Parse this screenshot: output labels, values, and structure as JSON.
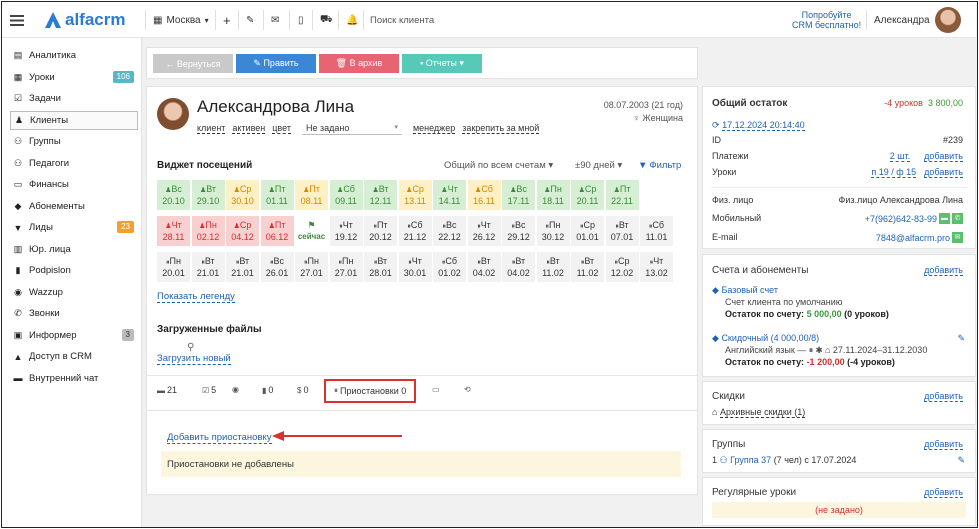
{
  "topbar": {
    "logo": "alfacrm",
    "city": "Москва",
    "search_placeholder": "Поиск клиента",
    "try_line1": "Попробуйте",
    "try_line2": "CRM бесплатно!",
    "user": "Александра"
  },
  "sidebar": [
    {
      "label": "Аналитика",
      "icon": "chart-icon"
    },
    {
      "label": "Уроки",
      "icon": "calendar-icon",
      "badge": "106",
      "badge_color": "#5bb5c8"
    },
    {
      "label": "Задачи",
      "icon": "tasks-icon"
    },
    {
      "label": "Клиенты",
      "icon": "user-icon",
      "active": true
    },
    {
      "label": "Группы",
      "icon": "group-icon"
    },
    {
      "label": "Педагоги",
      "icon": "teacher-icon"
    },
    {
      "label": "Финансы",
      "icon": "money-icon"
    },
    {
      "label": "Абонементы",
      "icon": "tag-icon"
    },
    {
      "label": "Лиды",
      "icon": "funnel-icon",
      "badge": "23",
      "badge_color": "#f0a030"
    },
    {
      "label": "Юр. лица",
      "icon": "building-icon"
    },
    {
      "label": "Podpislon",
      "icon": "doc-icon"
    },
    {
      "label": "Wazzup",
      "icon": "whatsapp-icon"
    },
    {
      "label": "Звонки",
      "icon": "phone-icon"
    },
    {
      "label": "Информер",
      "icon": "informer-icon",
      "badge": "3",
      "badge_color": "#bbb",
      "badge_text": "#333"
    },
    {
      "label": "Доступ в CRM",
      "icon": "lock-icon"
    },
    {
      "label": "Внутренний чат",
      "icon": "chat-icon"
    }
  ],
  "toolbar": {
    "back": "← Вернуться",
    "edit": "✎ Править",
    "archive": "🗑 В архив",
    "reports": "▪ Отчеты ▾"
  },
  "client": {
    "name": "Александрова Лина",
    "date": "08.07.2003 (21 год)",
    "gender": "♀ Женщина",
    "tags": [
      "клиент",
      "активен",
      "цвет"
    ],
    "select": "Не задано",
    "manager": "менеджер",
    "pin": "закрепить за мной"
  },
  "widget": {
    "title": "Виджет посещений",
    "filter1": "Общий по всем счетам ▾",
    "filter2": "±90 дней ▾",
    "filter_btn": "Фильтр",
    "legend_link": "Показать легенду"
  },
  "cells": [
    [
      "g",
      "Вс",
      "20.10"
    ],
    [
      "g",
      "Вт",
      "29.10"
    ],
    [
      "y",
      "Ср",
      "30.10"
    ],
    [
      "g",
      "Пт",
      "01.11"
    ],
    [
      "y",
      "Пт",
      "08.11"
    ],
    [
      "g",
      "Сб",
      "09.11"
    ],
    [
      "g",
      "Вт",
      "12.11"
    ],
    [
      "y",
      "Ср",
      "13.11"
    ],
    [
      "g",
      "Чт",
      "14.11"
    ],
    [
      "y",
      "Сб",
      "16.11"
    ],
    [
      "g",
      "Вс",
      "17.11"
    ],
    [
      "g",
      "Пн",
      "18.11"
    ],
    [
      "g",
      "Ср",
      "20.11"
    ],
    [
      "g",
      "Пт",
      "22.11"
    ],
    [
      "r",
      "Чт",
      "28.11"
    ],
    [
      "r",
      "Пн",
      "02.12"
    ],
    [
      "r",
      "Ср",
      "04.12"
    ],
    [
      "r",
      "Пт",
      "06.12"
    ],
    [
      "now",
      "",
      "сейчас"
    ],
    [
      "n",
      "Чт",
      "19.12"
    ],
    [
      "n",
      "Пт",
      "20.12"
    ],
    [
      "n",
      "Сб",
      "21.12"
    ],
    [
      "n",
      "Вс",
      "22.12"
    ],
    [
      "n",
      "Чт",
      "26.12"
    ],
    [
      "n",
      "Вс",
      "29.12"
    ],
    [
      "n",
      "Пн",
      "30.12"
    ],
    [
      "n",
      "Ср",
      "01.01"
    ],
    [
      "n",
      "Вт",
      "07.01"
    ],
    [
      "n",
      "Сб",
      "11.01"
    ],
    [
      "n",
      "Пн",
      "20.01"
    ],
    [
      "n",
      "Вт",
      "21.01"
    ],
    [
      "n",
      "Вт",
      "21.01"
    ],
    [
      "n",
      "Вс",
      "26.01"
    ],
    [
      "n",
      "Пн",
      "27.01"
    ],
    [
      "n",
      "Пн",
      "27.01"
    ],
    [
      "n",
      "Вт",
      "28.01"
    ],
    [
      "n",
      "Чт",
      "30.01"
    ],
    [
      "n",
      "Сб",
      "01.02"
    ],
    [
      "n",
      "Вт",
      "04.02"
    ],
    [
      "n",
      "Вт",
      "04.02"
    ],
    [
      "n",
      "Вт",
      "11.02"
    ],
    [
      "n",
      "Вт",
      "11.02"
    ],
    [
      "n",
      "Ср",
      "12.02"
    ],
    [
      "n",
      "Чт",
      "13.02"
    ]
  ],
  "files": {
    "title": "Загруженные файлы",
    "upload": "Загрузить новый"
  },
  "tabs": [
    {
      "label": "21",
      "icon": "comment-icon"
    },
    {
      "label": "5",
      "icon": "tasks-icon"
    },
    {
      "label": "",
      "icon": "whatsapp-icon"
    },
    {
      "label": "0",
      "icon": "doc-icon"
    },
    {
      "label": "0",
      "icon": "dollar-icon"
    },
    {
      "label": "Приостановки 0",
      "icon": "pause-icon",
      "active": true
    },
    {
      "label": "",
      "icon": "ticket-icon"
    },
    {
      "label": "",
      "icon": "history-icon"
    }
  ],
  "pauses": {
    "add": "Добавить приостановку",
    "empty": "Приостановки не добавлены"
  },
  "balance": {
    "title": "Общий остаток",
    "lessons": "-4 уроков",
    "money": "3 800,00",
    "date": "17.12.2024 20:14:40",
    "id_label": "ID",
    "id": "#239",
    "pay_label": "Платежи",
    "pay_val": "2 шт.",
    "lessons_label": "Уроки",
    "lessons_val": "п 19 / ф 15",
    "add": "добавить"
  },
  "contacts": {
    "type_label": "Физ. лицо",
    "type_val": "Физ.лицо Александрова Лина",
    "mob_label": "Мобильный",
    "mob_val": "+7(962)642-83-99",
    "email_label": "E-mail",
    "email_val": "7848@alfacrm.pro"
  },
  "accounts": {
    "title": "Счета и абонементы",
    "add": "добавить",
    "base": "Базовый счет",
    "base_desc": "Счет клиента по умолчанию",
    "base_rest_label": "Остаток по счету:",
    "base_rest_money": "5 000,00",
    "base_rest_lessons": "(0 уроков)",
    "disc": "Скидочный (4 000,00/8)",
    "disc_desc": "Английский язык — ⏸ ✱ ⌂ 27.11.2024–31.12.2030",
    "disc_rest_label": "Остаток по счету:",
    "disc_rest_money": "-1 200,00",
    "disc_rest_lessons": "(-4 уроков)"
  },
  "discounts": {
    "title": "Скидки",
    "add": "добавить",
    "archive": "Архивные скидки (1)"
  },
  "groups": {
    "title": "Группы",
    "add": "добавить",
    "item_num": "1",
    "item_link": "Группа 37",
    "item_rest": "(7 чел) с 17.07.2024"
  },
  "regular": {
    "title": "Регулярные уроки",
    "add": "добавить",
    "empty": "(не задано)"
  }
}
